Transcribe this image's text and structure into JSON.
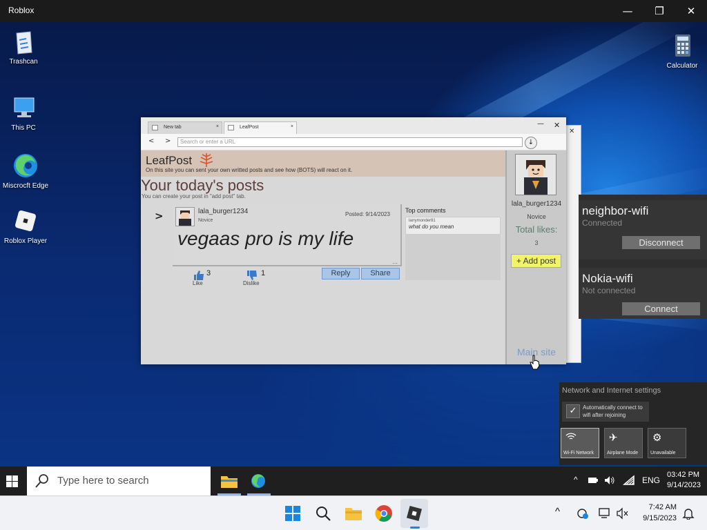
{
  "window": {
    "title": "Roblox",
    "minimize": "—",
    "maximize": "❐",
    "close": "✕"
  },
  "desktop": {
    "icons": [
      {
        "label": "Trashcan"
      },
      {
        "label": "This PC"
      },
      {
        "label": "Miscrocft Edge"
      },
      {
        "label": "Roblox Player"
      },
      {
        "label": "Calculator"
      }
    ]
  },
  "browser": {
    "tabs": [
      {
        "label": "New tab",
        "close": "×"
      },
      {
        "label": "LeafPost",
        "close": "×"
      }
    ],
    "minimize": "—",
    "close": "✕",
    "back": "<",
    "forward": ">",
    "address_placeholder": "Search or enter a URL",
    "download": "↓"
  },
  "site": {
    "name": "LeafPost",
    "description": "On this site you can sent your own writted posts and see how (BOTS) will react on it.",
    "posts_title": "Your today's posts",
    "posts_sub": "You can create your post in \"add post\" tab.",
    "post": {
      "arrow": ">",
      "username": "lala_burger1234",
      "rank": "Novice",
      "date": "Posted: 9/14/2023",
      "text": "vegaas pro is my life",
      "ellipsis": "...",
      "likes": "3",
      "like_label": "Like",
      "dislikes": "1",
      "dislike_label": "Dislike",
      "reply": "Reply",
      "share": "Share"
    },
    "comments": {
      "header": "Top comments",
      "items": [
        {
          "user": "larrymonder81",
          "text": "what do you mean"
        }
      ]
    },
    "profile": {
      "username": "lala_burger1234",
      "rank": "Novice",
      "likes_label": "Total likes:",
      "likes_value": "3",
      "add_post": "+ Add post",
      "main_site": "Main site"
    }
  },
  "wifi": {
    "networks": [
      {
        "name": "neighbor-wifi",
        "status": "Connected",
        "action": "Disconnect"
      },
      {
        "name": "Nokia-wifi",
        "status": "Not connected",
        "action": "Connect"
      }
    ],
    "settings_label": "Network and Internet settings",
    "auto_connect": "Automatically connect to wifi after rejoining",
    "tiles": [
      {
        "label": "Wi-Fi Network",
        "icon": "wifi-icon"
      },
      {
        "label": "Airplane Mode",
        "icon": "airplane-icon"
      },
      {
        "label": "Unavailable",
        "icon": "gear-icon"
      }
    ]
  },
  "inner_taskbar": {
    "search_placeholder": "Type here to search",
    "tray_chevron": "^",
    "lang": "ENG",
    "time": "03:42 PM",
    "date": "9/14/2023"
  },
  "win11_taskbar": {
    "tray_chevron": "^",
    "time": "7:42 AM",
    "date": "9/15/2023"
  },
  "colors": {
    "banner": "#d5c3b5",
    "add_post": "#f1f36a",
    "blue_button": "#a9c6e8"
  }
}
